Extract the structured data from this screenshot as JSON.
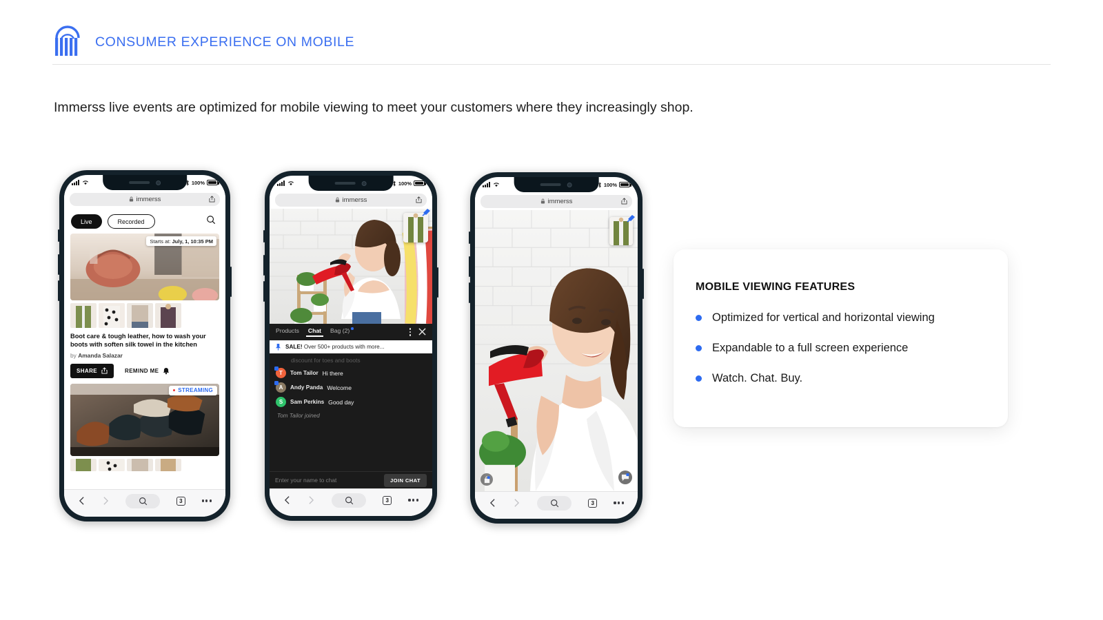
{
  "header": {
    "title": "CONSUMER EXPERIENCE ON MOBILE",
    "logo_icon": "immerss-arch-logo-icon",
    "accent_color": "#3b6ff0"
  },
  "intro": {
    "text": "Immerss live events are optimized for mobile viewing to meet your customers where they increasingly shop."
  },
  "phones": [
    {
      "id": "phone-browse",
      "status": {
        "signal_icon": "cellular-bars-icon",
        "wifi_icon": "wifi-icon",
        "bluetooth_icon": "bluetooth-icon",
        "battery_percent": "100%",
        "battery_icon": "battery-full-icon"
      },
      "browser": {
        "lock_icon": "lock-icon",
        "url": "immerss",
        "share_icon": "share-icon",
        "back_icon": "chevron-left-icon",
        "forward_icon": "chevron-right-icon",
        "search_icon": "search-icon",
        "tabs_count": "3",
        "more_icon": "ellipsis-icon"
      },
      "tabs": [
        {
          "label": "Live",
          "active": true
        },
        {
          "label": "Recorded",
          "active": false
        }
      ],
      "search_icon": "search-icon",
      "hero_badge": {
        "prefix": "Starts at: ",
        "value": "July, 1, 10:35 PM"
      },
      "event_title": "Boot care & tough leather, how to wash your boots with soften silk towel in the kitchen",
      "byline_prefix": "by ",
      "byline_author": "Amanda Salazar",
      "share_label": "SHARE",
      "share_icon": "share-icon",
      "remind_label": "REMIND ME",
      "remind_icon": "bell-icon",
      "streaming_label": "STREAMING"
    },
    {
      "id": "phone-chat",
      "status": {
        "battery_percent": "100%"
      },
      "browser": {
        "url": "immerss",
        "tabs_count": "3"
      },
      "product_pin_icon": "pin-icon",
      "chat_tabs": [
        {
          "label": "Products",
          "active": false
        },
        {
          "label": "Chat",
          "active": true
        },
        {
          "label": "Bag (2)",
          "active": false,
          "has_dot": true
        }
      ],
      "kebab_icon": "more-vertical-icon",
      "close_icon": "close-icon",
      "pinned": {
        "pin_icon": "pushpin-icon",
        "bold": "SALE!",
        "text": " Over 500+ products with more..."
      },
      "faded_message": "discount for toes and boots",
      "messages": [
        {
          "avatar_letter": "T",
          "avatar_color": "#f0633c",
          "name": "Tom Tailor",
          "text": "Hi there",
          "has_badge": true
        },
        {
          "avatar_letter": "A",
          "avatar_color": "#8a7a63",
          "name": "Andy Panda",
          "text": "Welcome",
          "has_badge": true
        },
        {
          "avatar_letter": "S",
          "avatar_color": "#2fc36b",
          "name": "Sam Perkins",
          "text": "Good day",
          "has_badge": false
        }
      ],
      "joined_notice": "Tom Tailor joined",
      "input_placeholder": "Enter your name to chat",
      "join_button": "JOIN CHAT"
    },
    {
      "id": "phone-fullscreen",
      "status": {
        "battery_percent": "100%"
      },
      "browser": {
        "url": "immerss",
        "tabs_count": "3"
      },
      "product_pin_icon": "pin-icon",
      "chat_bubble_icon": "chat-bubble-icon",
      "bag_icon": "shopping-bag-icon"
    }
  ],
  "feature_card": {
    "title": "MOBILE VIEWING FEATURES",
    "bullet_color": "#2d6bf0",
    "items": [
      "Optimized for vertical and horizontal viewing",
      "Expandable to a full screen experience",
      "Watch.  Chat.  Buy."
    ]
  }
}
